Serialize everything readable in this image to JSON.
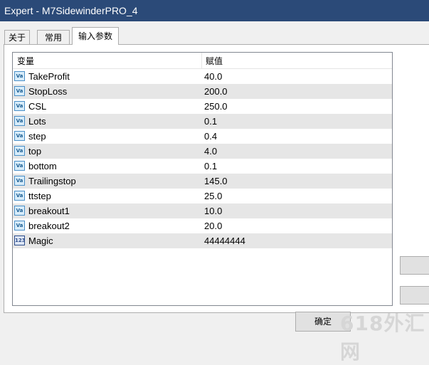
{
  "window": {
    "title": "Expert - M7SidewinderPRO_4"
  },
  "tabs": [
    {
      "label": "关于"
    },
    {
      "label": "常用"
    },
    {
      "label": "输入参数"
    }
  ],
  "table": {
    "headers": {
      "variable": "变量",
      "value": "赋值"
    },
    "rows": [
      {
        "name": "TakeProfit",
        "value": "40.0",
        "type": "double"
      },
      {
        "name": "StopLoss",
        "value": "200.0",
        "type": "double"
      },
      {
        "name": "CSL",
        "value": "250.0",
        "type": "double"
      },
      {
        "name": "Lots",
        "value": "0.1",
        "type": "double"
      },
      {
        "name": "step",
        "value": "0.4",
        "type": "double"
      },
      {
        "name": "top",
        "value": "4.0",
        "type": "double"
      },
      {
        "name": "bottom",
        "value": "0.1",
        "type": "double"
      },
      {
        "name": "Trailingstop",
        "value": "145.0",
        "type": "double"
      },
      {
        "name": "ttstep",
        "value": "25.0",
        "type": "double"
      },
      {
        "name": "breakout1",
        "value": "10.0",
        "type": "double"
      },
      {
        "name": "breakout2",
        "value": "20.0",
        "type": "double"
      },
      {
        "name": "Magic",
        "value": "44444444",
        "type": "int"
      }
    ]
  },
  "buttons": {
    "ok": "确定"
  },
  "watermark": "618外汇网"
}
